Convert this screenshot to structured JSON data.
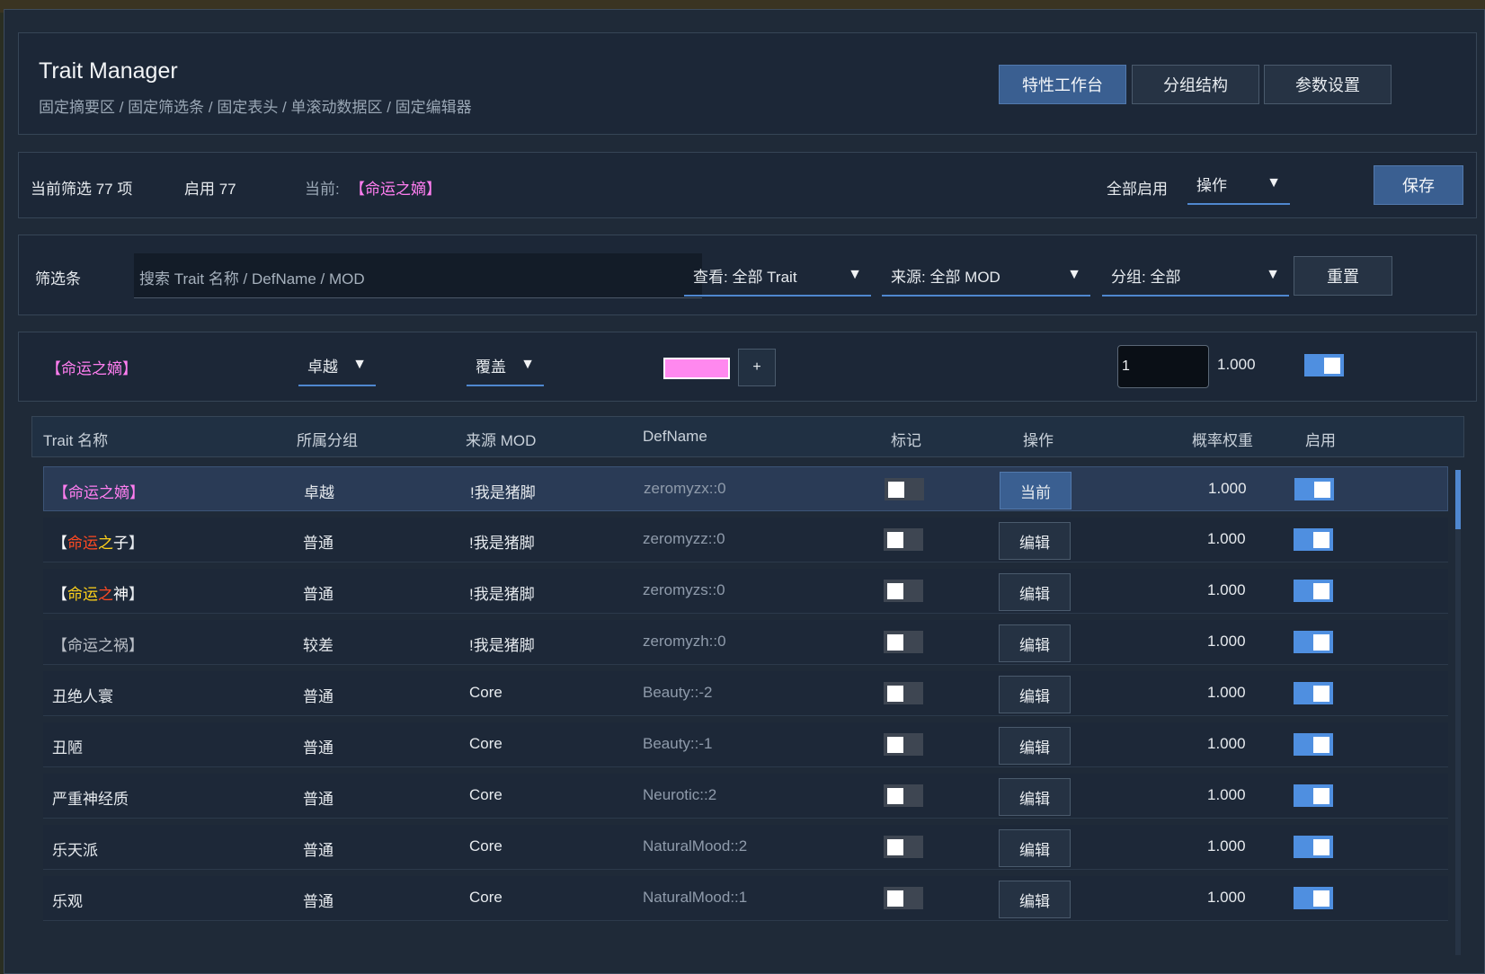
{
  "header": {
    "title": "Trait Manager",
    "subtitle": "固定摘要区 / 固定筛选条 / 固定表头 / 单滚动数据区 / 固定编辑器",
    "tabs": [
      {
        "label": "特性工作台",
        "active": true
      },
      {
        "label": "分组结构",
        "active": false
      },
      {
        "label": "参数设置",
        "active": false
      }
    ]
  },
  "summary": {
    "filtered_label": "当前筛选 77 项",
    "enabled_label": "启用 77",
    "current_prefix": "当前:",
    "current_name": "【命运之嫡】",
    "all_enable_label": "全部启用",
    "operation_select": "操作",
    "save_label": "保存"
  },
  "filter": {
    "label": "筛选条",
    "search_placeholder": "搜索 Trait 名称 / DefName / MOD",
    "view_select": "查看: 全部 Trait",
    "source_select": "来源: 全部 MOD",
    "group_select": "分组: 全部",
    "reset_label": "重置"
  },
  "editor": {
    "name": "【命运之嫡】",
    "rarity_select": "卓越",
    "mode_select": "覆盖",
    "color": "#ff88ef",
    "add_label": "+",
    "input_value": "1",
    "weight": "1.000",
    "enabled": true
  },
  "table": {
    "columns": [
      "Trait 名称",
      "所属分组",
      "来源 MOD",
      "DefName",
      "标记",
      "操作",
      "概率权重",
      "启用"
    ],
    "rows": [
      {
        "name": "【命运之嫡】",
        "group": "卓越",
        "mod": "!我是猪脚",
        "defname": "zeromyzx::0",
        "marked": false,
        "action": "当前",
        "weight": "1.000",
        "enabled": true,
        "selected": true
      },
      {
        "name": "【命运之子】",
        "group": "普通",
        "mod": "!我是猪脚",
        "defname": "zeromyzz::0",
        "marked": false,
        "action": "编辑",
        "weight": "1.000",
        "enabled": true,
        "selected": false
      },
      {
        "name": "【命运之神】",
        "group": "普通",
        "mod": "!我是猪脚",
        "defname": "zeromyzs::0",
        "marked": false,
        "action": "编辑",
        "weight": "1.000",
        "enabled": true,
        "selected": false
      },
      {
        "name": "【命运之祸】",
        "group": "较差",
        "mod": "!我是猪脚",
        "defname": "zeromyzh::0",
        "marked": false,
        "action": "编辑",
        "weight": "1.000",
        "enabled": true,
        "selected": false
      },
      {
        "name": "丑绝人寰",
        "group": "普通",
        "mod": "Core",
        "defname": "Beauty::-2",
        "marked": false,
        "action": "编辑",
        "weight": "1.000",
        "enabled": true,
        "selected": false
      },
      {
        "name": "丑陋",
        "group": "普通",
        "mod": "Core",
        "defname": "Beauty::-1",
        "marked": false,
        "action": "编辑",
        "weight": "1.000",
        "enabled": true,
        "selected": false
      },
      {
        "name": "严重神经质",
        "group": "普通",
        "mod": "Core",
        "defname": "Neurotic::2",
        "marked": false,
        "action": "编辑",
        "weight": "1.000",
        "enabled": true,
        "selected": false
      },
      {
        "name": "乐天派",
        "group": "普通",
        "mod": "Core",
        "defname": "NaturalMood::2",
        "marked": false,
        "action": "编辑",
        "weight": "1.000",
        "enabled": true,
        "selected": false
      },
      {
        "name": "乐观",
        "group": "普通",
        "mod": "Core",
        "defname": "NaturalMood::1",
        "marked": false,
        "action": "编辑",
        "weight": "1.000",
        "enabled": true,
        "selected": false
      }
    ]
  },
  "colors": {
    "accent": "#3a5f91",
    "toggle_on": "#4f8fe0",
    "pink": "#ff7ef0",
    "orange_red": "#ff4a22",
    "gold": "#ffd21a",
    "grey_name": "#b9bec6"
  },
  "icons": {
    "dropdown_arrow": "▼"
  }
}
